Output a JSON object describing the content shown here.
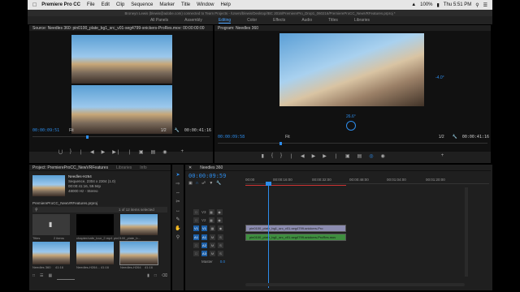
{
  "menubar": {
    "app": "Premiere Pro CC",
    "items": [
      "File",
      "Edit",
      "Clip",
      "Sequence",
      "Marker",
      "Title",
      "Window",
      "Help"
    ],
    "battery": "100%",
    "time": "Thu 5:51 PM"
  },
  "titlebar": "Broneyn Lewis (blewis@adobe.com) connected to Team Projects - /Users/blewis/Desktop/IBC 2016/PremierePro_Drop1_060216/PremiereProCC_NewVRFeatures.prproj *",
  "workspaces": {
    "items": [
      "All Panels",
      "Assembly",
      "Editing",
      "Color",
      "Effects",
      "Audio",
      "Titles",
      "Libraries"
    ],
    "active": "Editing"
  },
  "source": {
    "title": "Source: Needles 360: pin0100_plate_bg1_src_v01-seg4799-snickers-ProRes.mov: 00:00:00:00",
    "timecode": "00:00:09:51",
    "fit": "Fit",
    "page": "1/2",
    "duration": "00:00:41:16"
  },
  "program": {
    "title": "Program: Needles 360",
    "timecode": "00:00:09:58",
    "fit": "Fit",
    "page": "1/2",
    "duration": "00:00:41:16",
    "angle_h": "-4.0°",
    "angle_v": "26.6°"
  },
  "project": {
    "tabs": [
      "Project: PremiereProCC_NewVRFeatures",
      "Libraries",
      "Info"
    ],
    "clip_name": "Needles-H264",
    "clip_info": [
      "Sequence, 2304 x 2304 (1.0)",
      "00:00:41:16, 59.94p",
      "48000 Hz - Stereo"
    ],
    "file": "PremiereProCC_NewVRFeatures.prproj",
    "count": "1 of 12 items selected",
    "bins": [
      {
        "name": "Titles",
        "meta": "2 items"
      },
      {
        "name": "chapter/cafe_tour_2.mp4",
        "meta": "0:00"
      },
      {
        "name": "pin0100_plate_b...",
        "meta": "41:16"
      }
    ],
    "thumbs": [
      {
        "name": "Needles 360",
        "meta": "41:16"
      },
      {
        "name": "Needles-H264...",
        "meta": "41:16"
      },
      {
        "name": "Needles-H264",
        "meta": "41:16"
      }
    ]
  },
  "timeline": {
    "title": "Needles 360",
    "timecode": "00:00:09:59",
    "ruler": [
      "00:00",
      "00:00:16:00",
      "00:00:32:00",
      "00:00:48:00",
      "00:01:04:00",
      "00:01:20:00"
    ],
    "tracks": [
      "V3",
      "V2",
      "V1",
      "A1",
      "A2",
      "A3"
    ],
    "master": "Master",
    "master_val": "0.0",
    "clip_label": "pin0100_plate_bg1_src_v01-seg4799-snickers-Pro",
    "audio_label": "pin0100_plate_bg1_src_v01-seg4799-snickers-ProRes.mov"
  }
}
